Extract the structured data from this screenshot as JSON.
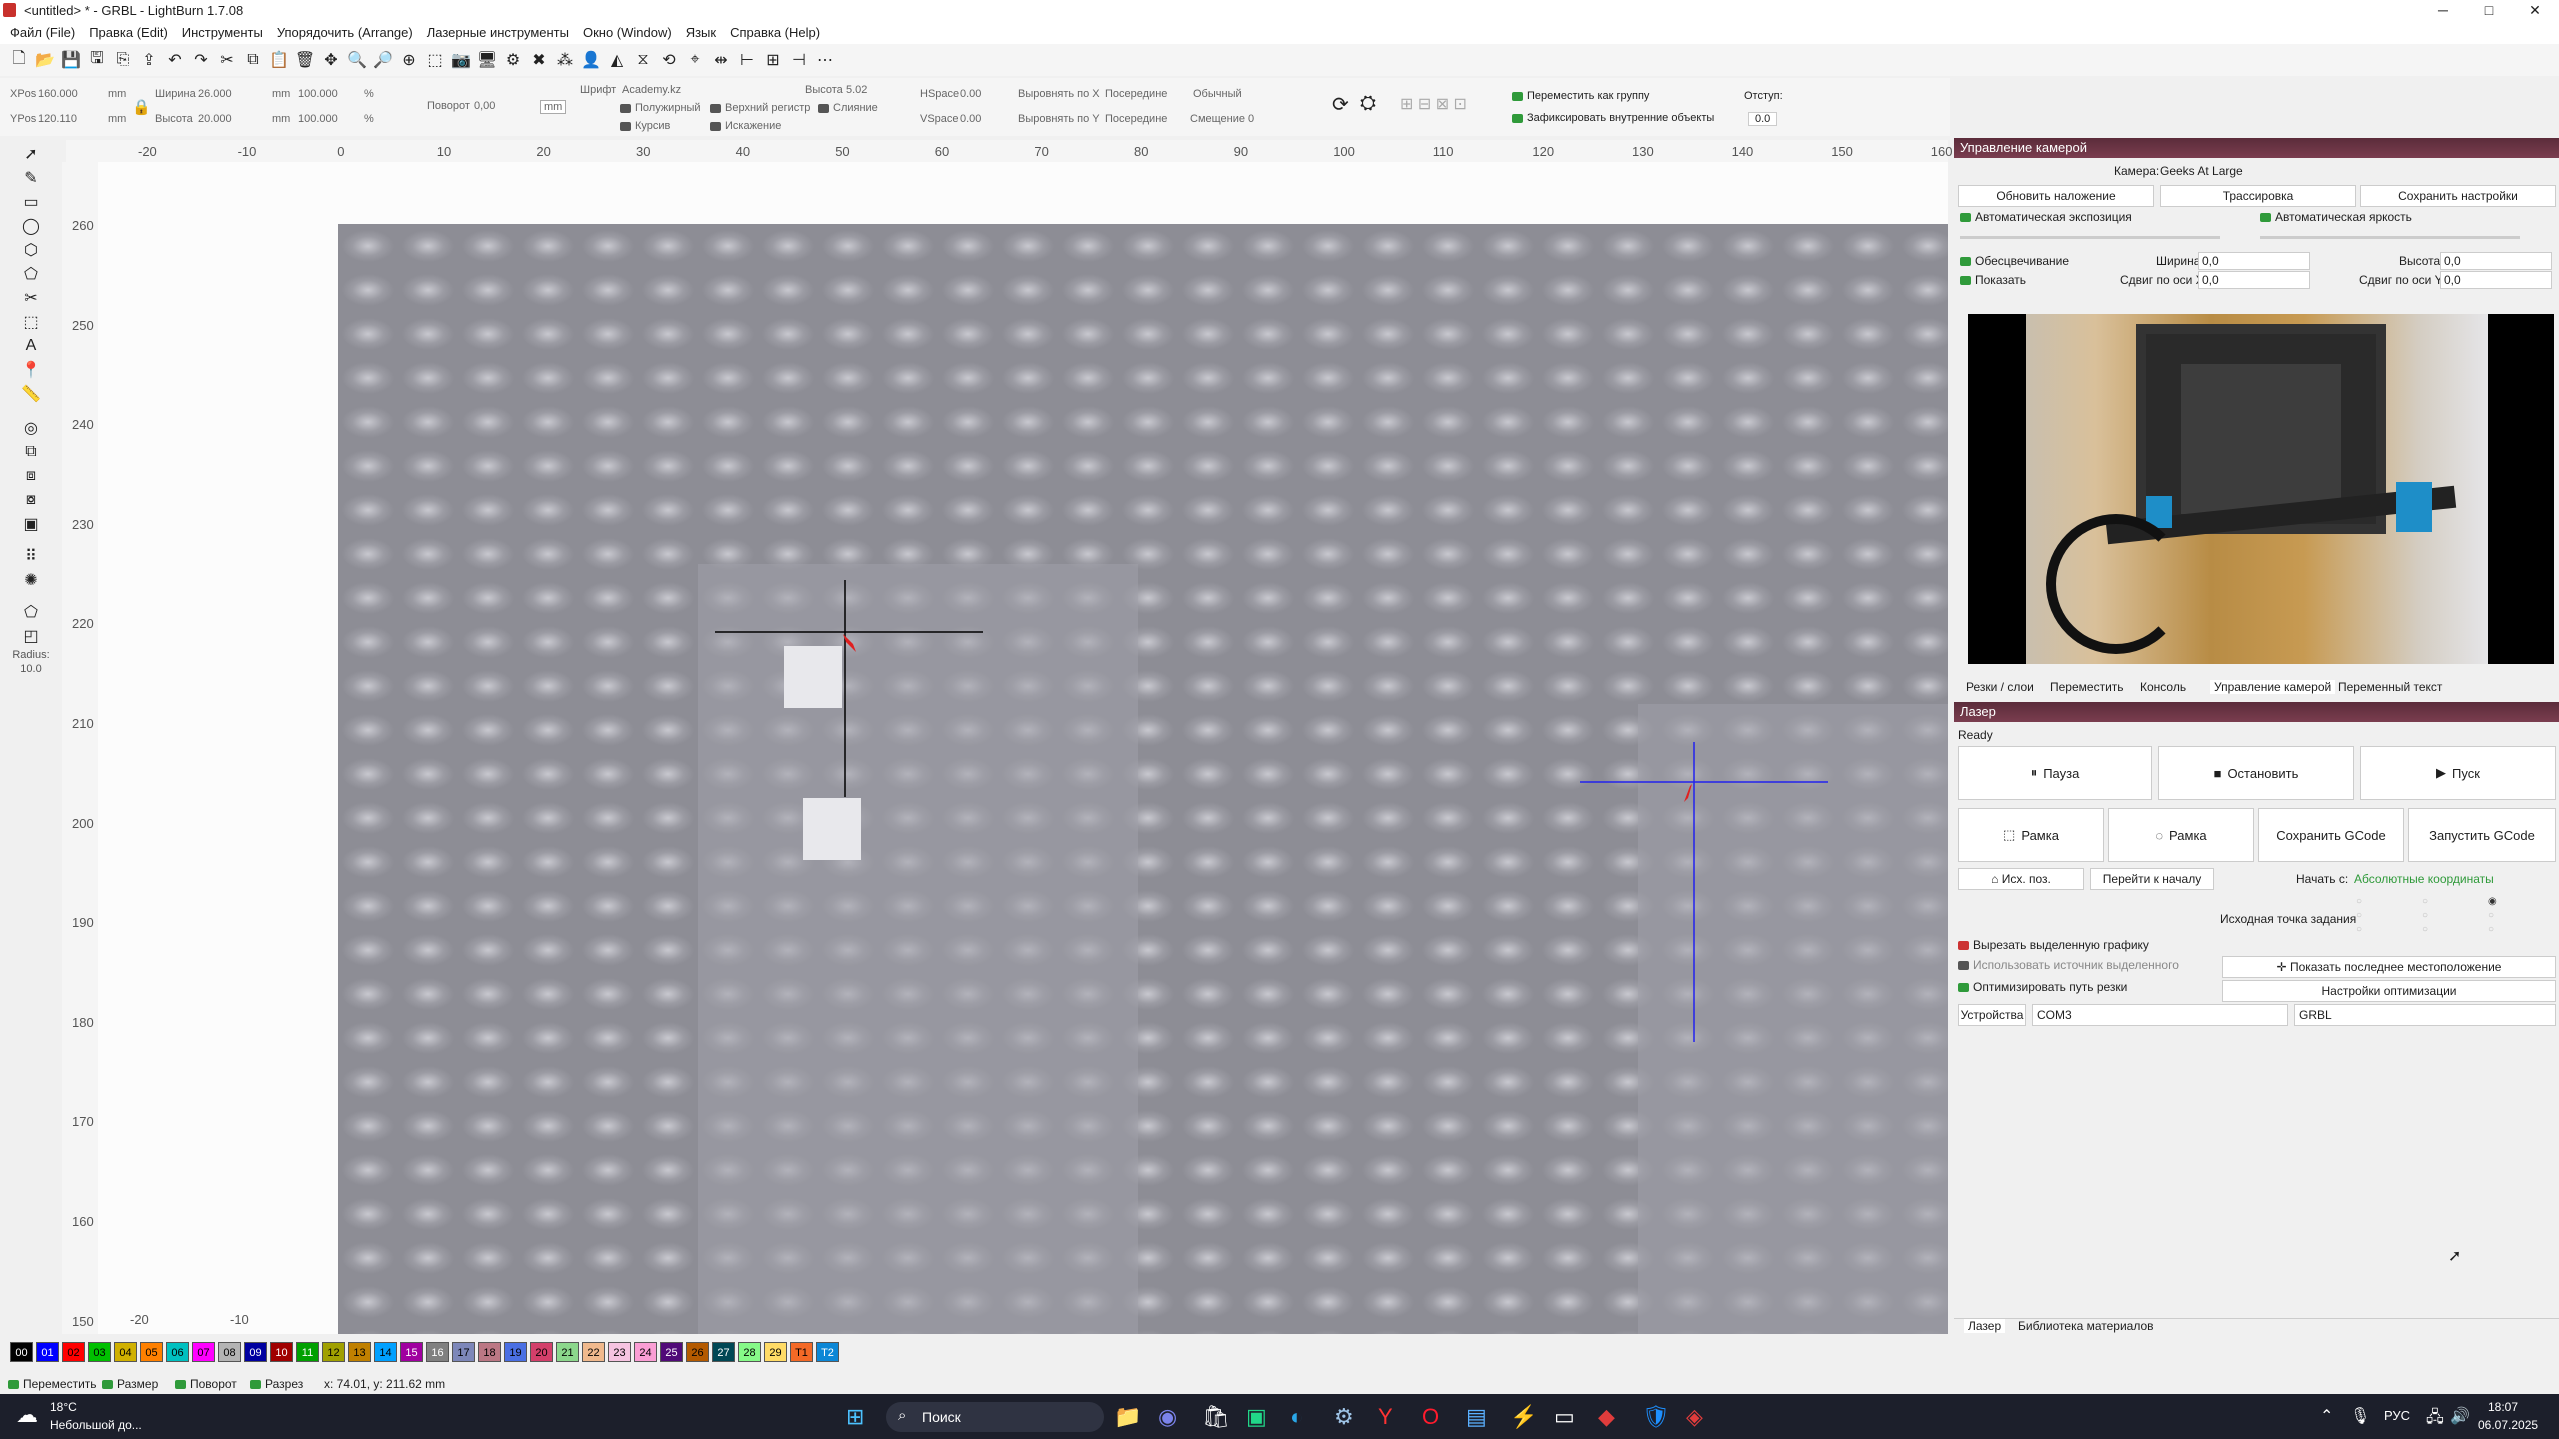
{
  "window": {
    "title": "<untitled> * - GRBL - LightBurn 1.7.08",
    "minimize": "─",
    "maximize": "□",
    "close": "✕"
  },
  "menu": [
    "Файл (File)",
    "Правка (Edit)",
    "Инструменты",
    "Упорядочить (Arrange)",
    "Лазерные инструменты",
    "Окно (Window)",
    "Язык",
    "Справка (Help)"
  ],
  "props": {
    "xpos_label": "XPos",
    "xpos": "160.000",
    "ypos_label": "YPos",
    "ypos": "120.110",
    "unit": "mm",
    "width_label": "Ширина",
    "width": "26.000",
    "height_label": "Высота",
    "height": "20.000",
    "scale_w": "100.000",
    "scale_h": "100.000",
    "pct": "%",
    "rotate_label": "Поворот",
    "rotate": "0,00",
    "mm_btn": "mm"
  },
  "font": {
    "font_label": "Шрифт",
    "font_value": "Academy.kz",
    "height_label": "Высота",
    "height_value": "5.02",
    "hspace_label": "HSpace",
    "hspace": "0.00",
    "vspace_label": "VSpace",
    "vspace": "0.00",
    "alignx_label": "Выровнять по X",
    "alignx": "Посередине",
    "aligny_label": "Выровнять по Y",
    "aligny": "Посередине",
    "style_value": "Обычный",
    "offset_label": "Смещение",
    "offset": "0",
    "bold": "Полужирный",
    "italic": "Курсив",
    "upper": "Верхний регистр",
    "distort": "Искажение",
    "merge": "Слияние"
  },
  "group": {
    "move_as_group": "Переместить как группу",
    "lock_inner": "Зафиксировать внутренние объекты",
    "indent_label": "Отступ:",
    "indent": "0.0"
  },
  "ruler": {
    "top": [
      "-20",
      "-10",
      "0",
      "10",
      "20",
      "30",
      "40",
      "50",
      "60",
      "70",
      "80",
      "90",
      "100",
      "110",
      "120",
      "130",
      "140",
      "150",
      "160"
    ],
    "left": [
      "260",
      "250",
      "240",
      "230",
      "220",
      "210",
      "200",
      "190",
      "180",
      "170",
      "160",
      "150"
    ],
    "bottom": [
      "-20",
      "-10"
    ]
  },
  "lefttools": {
    "radius_label": "Radius:",
    "radius": "10.0"
  },
  "palette": [
    "00",
    "01",
    "02",
    "03",
    "04",
    "05",
    "06",
    "07",
    "08",
    "09",
    "10",
    "11",
    "12",
    "13",
    "14",
    "15",
    "16",
    "17",
    "18",
    "19",
    "20",
    "21",
    "22",
    "23",
    "24",
    "25",
    "26",
    "27",
    "28",
    "29",
    "T1",
    "T2"
  ],
  "palette_colors": [
    "#000000",
    "#0000ff",
    "#ff0000",
    "#00c000",
    "#d0b000",
    "#ff8000",
    "#00c0c0",
    "#ff00ff",
    "#b4b4b4",
    "#0000a0",
    "#a00000",
    "#00a000",
    "#a0a000",
    "#c08000",
    "#00a0ff",
    "#a000a0",
    "#808080",
    "#7d87b9",
    "#bb7784",
    "#4a6fe3",
    "#d33f6a",
    "#8cd78c",
    "#f0b98d",
    "#f6c4e1",
    "#fa9ed4",
    "#500a78",
    "#b45a00",
    "#004754",
    "#86fa88",
    "#ffdb66",
    "#f36926",
    "#0c87d6"
  ],
  "camera": {
    "title": "Управление камерой",
    "camera_label": "Камера:",
    "camera_value": "Geeks At Large",
    "update_overlay": "Обновить наложение",
    "trace": "Трассировка",
    "save_settings": "Сохранить настройки",
    "auto_exposure": "Автоматическая экспозиция",
    "auto_brightness": "Автоматическая яркость",
    "fade": "Обесцвечивание",
    "show": "Показать",
    "width_label": "Ширина",
    "width": "0,0",
    "height_label": "Высота",
    "height": "0,0",
    "shift_x_label": "Сдвиг по оси X",
    "shift_x": "0,0",
    "shift_y_label": "Сдвиг по оси Y",
    "shift_y": "0,0"
  },
  "panel_tabs": [
    "Резки / слои",
    "Переместить",
    "Консоль",
    "Управление камерой",
    "Переменный текст"
  ],
  "laser": {
    "title": "Лазер",
    "status": "Ready",
    "pause": "Пауза",
    "stop": "Остановить",
    "start": "Пуск",
    "frame1": "Рамка",
    "frame2": "Рамка",
    "save_gcode": "Сохранить GCode",
    "run_gcode": "Запустить GCode",
    "home": "Исх. поз.",
    "go_origin": "Перейти к началу",
    "start_from_label": "Начать с:",
    "start_from": "Абсолютные координаты",
    "job_origin": "Исходная точка задания",
    "cut_selected": "Вырезать выделенную графику",
    "use_selection_origin": "Использовать источник выделенного",
    "optimize": "Оптимизировать путь резки",
    "show_last_position": "Показать последнее местоположение",
    "optimize_settings": "Настройки оптимизации",
    "devices": "Устройства",
    "port": "COM3",
    "device": "GRBL"
  },
  "bottom_tabs": [
    "Лазер",
    "Библиотека материалов"
  ],
  "status": {
    "move": "Переместить",
    "size": "Размер",
    "rotate": "Поворот",
    "shear": "Разрез",
    "coords": "x: 74.01, y: 211.62 mm"
  },
  "taskbar": {
    "temp": "18°C",
    "weather": "Небольшой до...",
    "search": "Поиск",
    "lang": "РУС",
    "time": "18:07",
    "date": "06.07.2025"
  },
  "colors": {
    "panel_header": "#6a3445",
    "check_on": "#2f9a3a",
    "crosshair_left": "#000000",
    "crosshair_right": "#2222ee",
    "arrow": "#e02020"
  }
}
